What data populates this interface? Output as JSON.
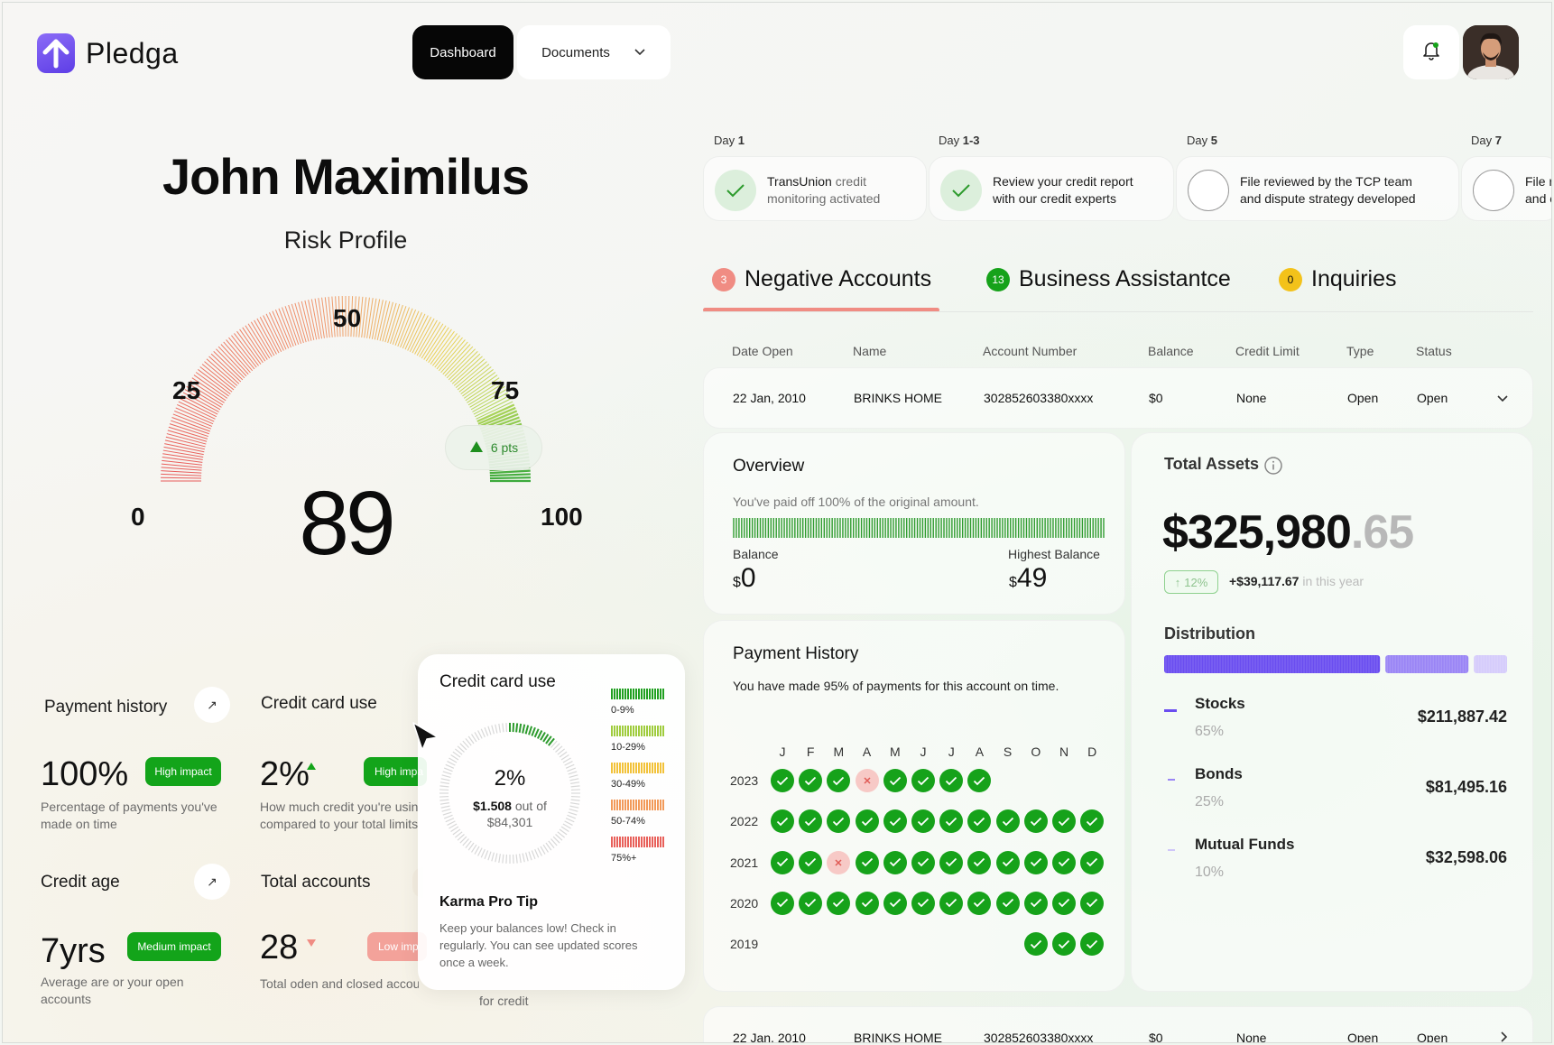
{
  "app": {
    "name": "Pledga"
  },
  "nav": {
    "dashboard": "Dashboard",
    "documents": "Documents"
  },
  "profile": {
    "name": "John Maximilus",
    "subtitle": "Risk Profile",
    "score": "89",
    "change": "6 pts",
    "gauge_labels": [
      "0",
      "25",
      "50",
      "75",
      "100"
    ]
  },
  "metrics": {
    "payment_history": {
      "title": "Payment history",
      "value": "100%",
      "badge": "High impact",
      "desc": [
        "Percentage of payments you've",
        "made on time"
      ]
    },
    "credit_card_use": {
      "title": "Credit card use",
      "value": "2%",
      "badge": "High impa",
      "desc": [
        "How much credit you're usin",
        "compared to your total limits"
      ]
    },
    "credit_age": {
      "title": "Credit age",
      "value": "7yrs",
      "badge": "Medium impact",
      "desc": [
        "Average are or your open",
        "accounts"
      ]
    },
    "total_accounts": {
      "title": "Total accounts",
      "value": "28",
      "badge": "Low imp",
      "desc": [
        "Total oden and closed accou"
      ]
    },
    "hidden_desc": "for credit"
  },
  "popover": {
    "title": "Credit card use",
    "percent": "2%",
    "amount": "$1.508",
    "out_of": "out of",
    "total": "$84,301",
    "legend": [
      "0-9%",
      "10-29%",
      "30-49%",
      "50-74%",
      "75%+"
    ],
    "tip_title": "Karma Pro Tip",
    "tip_text": [
      "Keep your balances low! Check in",
      "regularly. You can see updated scores",
      "once a week."
    ]
  },
  "timeline": [
    {
      "day_prefix": "Day",
      "day": "1",
      "bold": "TransUnion",
      "text1": " credit",
      "line2": "monitoring activated",
      "done": true
    },
    {
      "day_prefix": "Day",
      "day": "1-3",
      "bold": "",
      "text1": "Review your ",
      "bold2": "credit report",
      "line2": "with our credit experts",
      "done": true
    },
    {
      "day_prefix": "Day",
      "day": "5",
      "bold": "File reviewed",
      "text1": " by the TCP team",
      "line2": "and dispute strategy developed",
      "done": false
    },
    {
      "day_prefix": "Day",
      "day": "7",
      "bold": "File r",
      "text1": "",
      "line2": "and c",
      "done": false
    }
  ],
  "tabs": [
    {
      "count": "3",
      "label": "Negative Accounts"
    },
    {
      "count": "13",
      "label": "Business Assistantce"
    },
    {
      "count": "0",
      "label": "Inquiries"
    }
  ],
  "table": {
    "headers": [
      "Date Open",
      "Name",
      "Account Number",
      "Balance",
      "Credit Limit",
      "Type",
      "Status"
    ],
    "rows": [
      [
        "22 Jan, 2010",
        "BRINKS HOME",
        "302852603380xxxx",
        "$0",
        "None",
        "Open",
        "Open"
      ],
      [
        "22 Jan, 2010",
        "BRINKS HOME",
        "302852603380xxxx",
        "$0",
        "None",
        "Open",
        "Open"
      ]
    ]
  },
  "overview": {
    "title": "Overview",
    "desc": "You've paid off 100% of the original amount.",
    "paid_fraction": 1.0,
    "balance_label": "Balance",
    "balance_currency": "$",
    "balance": "0",
    "highest_label": "Highest Balance",
    "highest_currency": "$",
    "highest": "49"
  },
  "payment_history": {
    "title": "Payment History",
    "desc": "You have made 95% of payments for this account on time.",
    "months": [
      "J",
      "F",
      "M",
      "A",
      "M",
      "J",
      "J",
      "A",
      "S",
      "O",
      "N",
      "D"
    ],
    "years": [
      {
        "year": "2023",
        "status": [
          "ok",
          "ok",
          "ok",
          "bad",
          "ok",
          "ok",
          "ok",
          "ok",
          "",
          "",
          "",
          ""
        ]
      },
      {
        "year": "2022",
        "status": [
          "ok",
          "ok",
          "ok",
          "ok",
          "ok",
          "ok",
          "ok",
          "ok",
          "ok",
          "ok",
          "ok",
          "ok"
        ]
      },
      {
        "year": "2021",
        "status": [
          "ok",
          "ok",
          "bad",
          "ok",
          "ok",
          "ok",
          "ok",
          "ok",
          "ok",
          "ok",
          "ok",
          "ok"
        ]
      },
      {
        "year": "2020",
        "status": [
          "ok",
          "ok",
          "ok",
          "ok",
          "ok",
          "ok",
          "ok",
          "ok",
          "ok",
          "ok",
          "ok",
          "ok"
        ]
      },
      {
        "year": "2019",
        "status": [
          "",
          "",
          "",
          "",
          "",
          "",
          "",
          "",
          "",
          "ok",
          "ok",
          "ok"
        ]
      }
    ]
  },
  "assets": {
    "title": "Total Assets",
    "amount_main": "$325,980",
    "amount_cents": ".65",
    "change_pct": "12%",
    "change_amount": "+$39,117.67",
    "change_period": "in this year",
    "distribution_title": "Distribution",
    "items": [
      {
        "name": "Stocks",
        "pct": "65%",
        "value": "$211,887.42",
        "fraction": 0.65,
        "color": "#6a4df0"
      },
      {
        "name": "Bonds",
        "pct": "25%",
        "value": "$81,495.16",
        "fraction": 0.25,
        "color": "#9a85f5"
      },
      {
        "name": "Mutual Funds",
        "pct": "10%",
        "value": "$32,598.06",
        "fraction": 0.1,
        "color": "#d5ccfb"
      }
    ]
  },
  "colors": {
    "accent_green": "#16a21a",
    "accent_purple": "#6a4df0",
    "negative_red": "#f08c83"
  }
}
